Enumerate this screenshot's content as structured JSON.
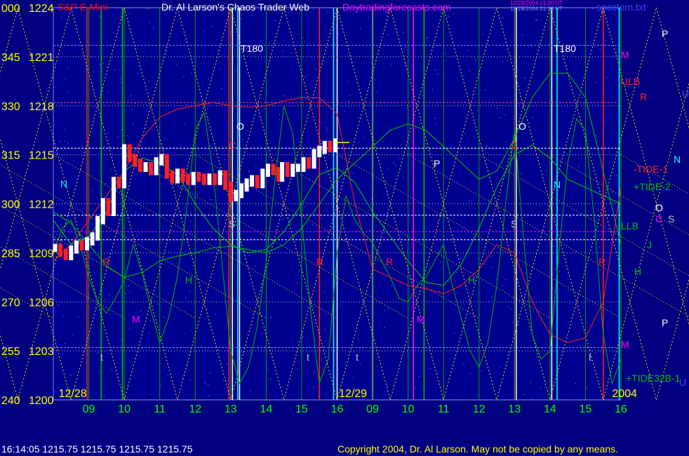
{
  "header": {
    "symbol": "S&P E-Mini",
    "title": "Dr. Al Larson's Chaos Trader Web",
    "site": "Daytradingforecasts.com",
    "timestamp_line1": "12/29/2004 21:30 UT",
    "timestamp_line2": "12/28/2004 21:30 UT",
    "filename": "spcctom.txt"
  },
  "footer": {
    "quote": "16:14:05  1215.75 1215.75 1215.75 1215.75",
    "copyright": "Copyright 2004, Dr. Al Larson. May not be copied by any means."
  },
  "colors": {
    "background": "#000080",
    "plot_background": "#000090",
    "price_label": "#FFFF00",
    "angle_label": "#FFFF00",
    "grid": "#C0C0C0",
    "white": "#FFFFFF",
    "red": "#FF2020",
    "green": "#00C000",
    "magenta": "#FF00FF",
    "cyan": "#00FFFF",
    "blue": "#4040FF"
  },
  "chart_data": {
    "type": "line",
    "title": "S&P E-Mini",
    "y_ticks": [
      {
        "angle": "000",
        "price": "1224",
        "value": 1224
      },
      {
        "angle": "345",
        "price": "1221",
        "value": 1221
      },
      {
        "angle": "330",
        "price": "1218",
        "value": 1218
      },
      {
        "angle": "315",
        "price": "1215",
        "value": 1215
      },
      {
        "angle": "300",
        "price": "1212",
        "value": 1212
      },
      {
        "angle": "285",
        "price": "1209",
        "value": 1209
      },
      {
        "angle": "270",
        "price": "1206",
        "value": 1206
      },
      {
        "angle": "255",
        "price": "1203",
        "value": 1203
      },
      {
        "angle": "240",
        "price": "1200",
        "value": 1200
      }
    ],
    "ylim": [
      1200,
      1224
    ],
    "xlim": [
      0,
      16
    ],
    "x_ticks": [
      {
        "label": "09",
        "x": 1
      },
      {
        "label": "10",
        "x": 2
      },
      {
        "label": "11",
        "x": 3
      },
      {
        "label": "12",
        "x": 4
      },
      {
        "label": "13",
        "x": 5
      },
      {
        "label": "14",
        "x": 6
      },
      {
        "label": "15",
        "x": 7
      },
      {
        "label": "16",
        "x": 8
      },
      {
        "label": "09",
        "x": 9
      },
      {
        "label": "10",
        "x": 10
      },
      {
        "label": "11",
        "x": 11
      },
      {
        "label": "12",
        "x": 12
      },
      {
        "label": "13",
        "x": 13
      },
      {
        "label": "14",
        "x": 14
      },
      {
        "label": "15",
        "x": 15
      },
      {
        "label": "16",
        "x": 16
      }
    ],
    "date_labels": [
      {
        "text": "12/28",
        "x": 0.15
      },
      {
        "text": "12/29",
        "x": 8.05
      },
      {
        "text": "2004",
        "x": 15.75
      }
    ],
    "price_bars": {
      "x": [
        0.05,
        0.2,
        0.35,
        0.5,
        0.65,
        0.8,
        0.95,
        1.1,
        1.25,
        1.4,
        1.55,
        1.7,
        1.85,
        2.0,
        2.15,
        2.3,
        2.45,
        2.6,
        2.75,
        2.9,
        3.05,
        3.2,
        3.35,
        3.5,
        3.65,
        3.8,
        3.95,
        4.1,
        4.25,
        4.4,
        4.55,
        4.7,
        4.85,
        5.0,
        5.15,
        5.3,
        5.45,
        5.6,
        5.75,
        5.9,
        6.05,
        6.2,
        6.35,
        6.45,
        6.6,
        6.75,
        6.9,
        7.05,
        7.2,
        7.35,
        7.5,
        7.65,
        7.8,
        7.95
      ],
      "close": [
        1209.3,
        1209.0,
        1208.8,
        1209.2,
        1209.5,
        1209.4,
        1209.7,
        1210.0,
        1211.0,
        1212.1,
        1211.5,
        1213.4,
        1213.2,
        1215.4,
        1214.8,
        1214.5,
        1214.2,
        1214.3,
        1214.0,
        1214.6,
        1214.8,
        1213.8,
        1213.5,
        1213.9,
        1213.6,
        1213.4,
        1213.7,
        1213.6,
        1213.4,
        1213.6,
        1213.4,
        1213.8,
        1213.1,
        1212.4,
        1212.6,
        1213.0,
        1213.3,
        1213.5,
        1213.2,
        1213.9,
        1214.2,
        1214.0,
        1213.6,
        1214.3,
        1213.9,
        1214.2,
        1214.2,
        1214.6,
        1214.4,
        1215.1,
        1215.3,
        1215.6,
        1215.4,
        1215.75
      ]
    },
    "series": [
      {
        "name": "-TIDE-1",
        "x": [
          0,
          0.5,
          1,
          1.5,
          2,
          2.5,
          3,
          3.5,
          4,
          4.5,
          5,
          5.5,
          6,
          6.5,
          7,
          7.5,
          8,
          8.5,
          9,
          9.5,
          10,
          10.5,
          11,
          11.5,
          12,
          12.5,
          13,
          13.5,
          14,
          14.5,
          15,
          15.5,
          16
        ],
        "y": [
          1208.5,
          1209.5,
          1211,
          1212.5,
          1214,
          1216,
          1217.3,
          1217.8,
          1218.0,
          1218.2,
          1218.0,
          1217.9,
          1218.0,
          1218.3,
          1218.5,
          1218.5,
          1217.5,
          1212,
          1208,
          1207.5,
          1207,
          1206.8,
          1206.5,
          1207,
          1208,
          1209.5,
          1209,
          1206,
          1204,
          1203.5,
          1203.8,
          1206,
          1213
        ]
      },
      {
        "name": "+TIDE-2",
        "x": [
          0,
          0.5,
          1,
          1.5,
          2,
          2.5,
          3,
          3.5,
          4,
          4.5,
          5,
          5.5,
          6,
          6.5,
          7,
          7.5,
          8,
          8.5,
          9,
          9.5,
          10,
          10.5,
          11,
          11.5,
          12,
          12.5,
          13,
          13.5,
          14,
          14.5,
          15,
          15.5,
          16
        ],
        "y": [
          1211.5,
          1210.8,
          1209.5,
          1208.2,
          1207.5,
          1207.8,
          1208.5,
          1208.8,
          1209.0,
          1209.3,
          1209.4,
          1209.2,
          1209.0,
          1209.5,
          1210.5,
          1212,
          1213.5,
          1214.5,
          1215.5,
          1216.5,
          1216.9,
          1216.5,
          1215.5,
          1214.5,
          1213.5,
          1214,
          1216,
          1218.5,
          1220.0,
          1220.0,
          1218.5,
          1214,
          1209.5
        ]
      },
      {
        "name": "LLB",
        "x": [
          0,
          0.5,
          1,
          1.5,
          2,
          2.5,
          3,
          3.5,
          4,
          4.5,
          5,
          5.5,
          6,
          6.5,
          7,
          7.5,
          8,
          8.5,
          9,
          9.5,
          10,
          10.5,
          11,
          11.5,
          12,
          12.5,
          13,
          13.5,
          14,
          14.5,
          15,
          15.5,
          16
        ],
        "y": [
          1211,
          1209.5,
          1210,
          1211.5,
          1214,
          1214.8,
          1214.5,
          1213.8,
          1212,
          1210.5,
          1209.5,
          1209.0,
          1209.2,
          1210.3,
          1212,
          1213.8,
          1214.2,
          1213.3,
          1211.5,
          1210,
          1208.5,
          1207.2,
          1207,
          1208.3,
          1210.5,
          1213,
          1215,
          1215.6,
          1214.8,
          1213.5,
          1213,
          1212.5,
          1212
        ]
      },
      {
        "name": "+TIDE32B-1",
        "x": [
          0,
          0.25,
          0.5,
          0.75,
          1,
          1.25,
          1.5,
          1.75,
          2,
          2.25,
          2.5,
          2.75,
          3,
          3.25,
          3.5,
          3.75,
          4,
          4.25,
          4.5,
          4.75,
          5,
          5.25,
          5.5,
          5.75,
          6,
          6.25,
          6.5,
          6.75,
          7,
          7.25,
          7.5,
          7.75,
          8,
          8.25,
          8.5,
          8.75,
          9,
          9.25,
          9.5,
          9.75,
          10,
          10.25,
          10.5,
          10.75,
          11,
          11.25,
          11.5,
          11.75,
          12,
          12.25,
          12.5,
          12.75,
          13,
          13.25,
          13.5,
          13.75,
          14,
          14.25,
          14.5,
          14.75,
          15,
          15.25,
          15.5,
          15.75,
          16
        ],
        "y": [
          1209,
          1210.5,
          1211,
          1209.5,
          1207.5,
          1206,
          1205.3,
          1206.2,
          1207.3,
          1209.5,
          1207.8,
          1205.5,
          1203.5,
          1205,
          1207.6,
          1211.5,
          1216.5,
          1217.6,
          1214,
          1208.5,
          1203,
          1201,
          1202,
          1204.5,
          1208.5,
          1213.5,
          1218,
          1216.3,
          1211,
          1205.5,
          1201,
          1202.5,
          1209,
          1212.5,
          1211,
          1210.2,
          1209.6,
          1208.5,
          1207.5,
          1206.2,
          1206,
          1207,
          1207.5,
          1208.5,
          1209.5,
          1207,
          1205,
          1203,
          1202,
          1203.5,
          1207,
          1212,
          1216.5,
          1210,
          1204,
          1202.5,
          1203,
          1209,
          1214.5,
          1217.2,
          1216.5,
          1211,
          1204,
          1201,
          1202.5
        ]
      }
    ],
    "right_labels": [
      {
        "text": "P",
        "color": "#FFFFFF"
      },
      {
        "text": "M",
        "color": "#FF00FF"
      },
      {
        "text": "ULB",
        "color": "#FF2020"
      },
      {
        "text": "R",
        "color": "#FF2020"
      },
      {
        "text": "U",
        "color": "#4040FF"
      },
      {
        "text": "N",
        "color": "#00FFFF"
      },
      {
        "text": "-TIDE-1",
        "color": "#FF2020"
      },
      {
        "text": "+TIDE-2",
        "color": "#00C000"
      },
      {
        "text": "O",
        "color": "#FFFFFF"
      },
      {
        "text": "C",
        "color": "#FF00FF"
      },
      {
        "text": "S",
        "color": "#C0C0C0"
      },
      {
        "text": "LLB",
        "color": "#00C000"
      },
      {
        "text": "J",
        "color": "#00C000"
      },
      {
        "text": "H",
        "color": "#00C000"
      },
      {
        "text": "P",
        "color": "#FFFFFF"
      },
      {
        "text": "M",
        "color": "#FF00FF"
      },
      {
        "text": "+TIDE32B-1",
        "color": "#00C000"
      },
      {
        "text": "U",
        "color": "#4040FF"
      }
    ],
    "annotations": [
      {
        "text": "T180",
        "color": "#FFFFFF"
      },
      {
        "text": "T180",
        "color": "#FFFFFF"
      },
      {
        "text": "O",
        "color": "#FFFFFF"
      },
      {
        "text": "O",
        "color": "#FFFFFF"
      },
      {
        "text": "N",
        "color": "#00FFFF"
      },
      {
        "text": "N",
        "color": "#00FFFF"
      },
      {
        "text": "P",
        "color": "#FFFFFF"
      },
      {
        "text": "R",
        "color": "#FF2020"
      },
      {
        "text": "R",
        "color": "#FF2020"
      },
      {
        "text": "R",
        "color": "#FF2020"
      },
      {
        "text": "R",
        "color": "#FF2020"
      },
      {
        "text": "M",
        "color": "#FF00FF"
      },
      {
        "text": "M",
        "color": "#FF00FF"
      },
      {
        "text": "H",
        "color": "#00C000"
      },
      {
        "text": "H",
        "color": "#00C000"
      },
      {
        "text": "S",
        "color": "#C0C0C0"
      },
      {
        "text": "S",
        "color": "#C0C0C0"
      },
      {
        "text": "C",
        "color": "#FF2020"
      },
      {
        "text": "C",
        "color": "#FF2020"
      },
      {
        "text": "t",
        "color": "#C0C0C0"
      },
      {
        "text": "t",
        "color": "#C0C0C0"
      },
      {
        "text": "t",
        "color": "#C0C0C0"
      },
      {
        "text": "t",
        "color": "#C0C0C0"
      }
    ],
    "vertical_lines": [
      {
        "x": 0.95,
        "color": "#FF2020"
      },
      {
        "x": 1.35,
        "color": "#00C000"
      },
      {
        "x": 1.95,
        "color": "#00C000"
      },
      {
        "x": 4.95,
        "color": "#FF2020"
      },
      {
        "x": 5.05,
        "color": "#FFFFFF"
      },
      {
        "x": 5.2,
        "color": "#00FFFF"
      },
      {
        "x": 5.25,
        "color": "#FFFFFF"
      },
      {
        "x": 7.5,
        "color": "#FF2020"
      },
      {
        "x": 7.9,
        "color": "#00FFFF"
      },
      {
        "x": 9.0,
        "color": "#FFFFFF"
      },
      {
        "x": 10.15,
        "color": "#FF00FF"
      },
      {
        "x": 10.45,
        "color": "#00C000"
      },
      {
        "x": 13.05,
        "color": "#FFFFFF"
      },
      {
        "x": 13.0,
        "color": "#FF2020"
      },
      {
        "x": 14.05,
        "color": "#FFFFFF"
      },
      {
        "x": 14.2,
        "color": "#00FFFF"
      },
      {
        "x": 15.5,
        "color": "#FF2020"
      },
      {
        "x": 15.95,
        "color": "#00FFFF"
      }
    ],
    "horizontal_levels": [
      {
        "y": 1221.7,
        "color": "#8080FF"
      },
      {
        "y": 1218.2,
        "color": "#FF4040"
      },
      {
        "y": 1215.4,
        "color": "#FFFFFF"
      },
      {
        "y": 1211.3,
        "color": "#FFFFFF"
      },
      {
        "y": 1210.3,
        "color": "#FF00FF"
      },
      {
        "y": 1209.8,
        "color": "#FFFFFF"
      },
      {
        "y": 1203.2,
        "color": "#8080FF"
      }
    ]
  }
}
